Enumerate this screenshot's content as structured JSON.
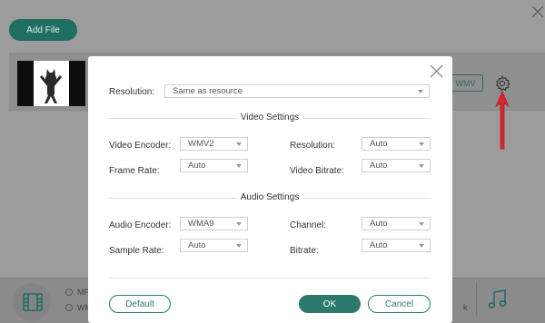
{
  "background": {
    "add_file_label": "Add File",
    "format_badge": "WMV",
    "option_1_partial": "MP",
    "option_2_partial": "WM",
    "trailing_text_partial": "k"
  },
  "dialog": {
    "resolution_label": "Resolution:",
    "resolution_value": "Same as resource",
    "video_section_title": "Video Settings",
    "video": {
      "encoder_label": "Video Encoder:",
      "encoder_value": "WMV2",
      "frame_rate_label": "Frame Rate:",
      "frame_rate_value": "Auto",
      "resolution_label": "Resolution:",
      "resolution_value": "Auto",
      "bitrate_label": "Video Bitrate:",
      "bitrate_value": "Auto"
    },
    "audio_section_title": "Audio Settings",
    "audio": {
      "encoder_label": "Audio Encoder:",
      "encoder_value": "WMA9",
      "sample_rate_label": "Sample Rate:",
      "sample_rate_value": "Auto",
      "channel_label": "Channel:",
      "channel_value": "Auto",
      "bitrate_label": "Bitrate:",
      "bitrate_value": "Auto"
    },
    "default_button": "Default",
    "ok_button": "OK",
    "cancel_button": "Cancel"
  },
  "colors": {
    "accent": "#2b7a6c",
    "overlay": "#9b9b9b",
    "arrow": "#d9262b"
  },
  "icons": [
    "close-icon",
    "gear-icon",
    "film-icon",
    "music-note-icon",
    "red-arrow-indicator"
  ]
}
